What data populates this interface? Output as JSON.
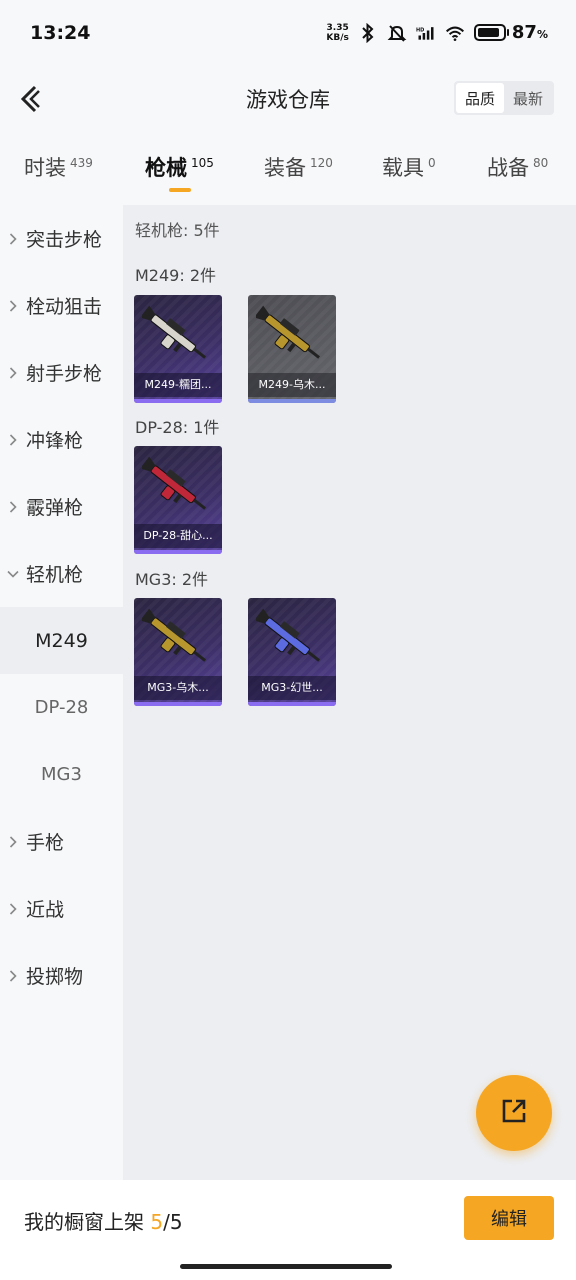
{
  "status_bar": {
    "time": "13:24",
    "net_speed_value": "3.35",
    "net_speed_unit": "KB/s",
    "battery_percent": "87",
    "battery_unit": "%",
    "battery_level": 0.87,
    "icons": [
      "bluetooth-icon",
      "mute-bell-icon",
      "hd-signal-icon",
      "wifi-icon",
      "battery-icon"
    ]
  },
  "header": {
    "title": "游戏仓库",
    "sort_options": [
      "品质",
      "最新"
    ],
    "sort_active": "品质"
  },
  "tabs": [
    {
      "label": "时装",
      "count": "439"
    },
    {
      "label": "枪械",
      "count": "105",
      "active": true
    },
    {
      "label": "装备",
      "count": "120"
    },
    {
      "label": "载具",
      "count": "0"
    },
    {
      "label": "战备",
      "count": "80"
    }
  ],
  "sidebar": {
    "items": [
      {
        "label": "突击步枪",
        "icon": "chevron-right-icon"
      },
      {
        "label": "栓动狙击",
        "icon": "chevron-right-icon"
      },
      {
        "label": "射手步枪",
        "icon": "chevron-right-icon"
      },
      {
        "label": "冲锋枪",
        "icon": "chevron-right-icon"
      },
      {
        "label": "霰弹枪",
        "icon": "chevron-right-icon"
      },
      {
        "label": "轻机枪",
        "icon": "chevron-down-icon",
        "expanded": true
      },
      {
        "label": "手枪",
        "icon": "chevron-right-icon"
      },
      {
        "label": "近战",
        "icon": "chevron-right-icon"
      },
      {
        "label": "投掷物",
        "icon": "chevron-right-icon"
      }
    ],
    "sub_items": [
      {
        "label": "M249",
        "selected": true
      },
      {
        "label": "DP-28"
      },
      {
        "label": "MG3"
      }
    ]
  },
  "main": {
    "summary": "轻机枪: 5件",
    "groups": [
      {
        "title": "M249: 2件",
        "items": [
          {
            "name": "M249-糯团...",
            "color": "#d8d6cc",
            "bg": "purple"
          },
          {
            "name": "M249-乌木...",
            "color": "#b8962e",
            "bg": "gray"
          }
        ]
      },
      {
        "title": "DP-28: 1件",
        "items": [
          {
            "name": "DP-28-甜心...",
            "color": "#c0283a",
            "bg": "purple"
          }
        ]
      },
      {
        "title": "MG3: 2件",
        "items": [
          {
            "name": "MG3-乌木...",
            "color": "#b8962e",
            "bg": "purple"
          },
          {
            "name": "MG3-幻世...",
            "color": "#5d6be0",
            "bg": "purple"
          }
        ]
      }
    ]
  },
  "bottom_bar": {
    "shelf_label": "我的橱窗上架",
    "shelf_current": "5",
    "shelf_separator": "/",
    "shelf_total": "5",
    "edit_label": "编辑"
  },
  "colors": {
    "accent": "#f5a623",
    "rarity_purple": "#8a6cf0"
  }
}
